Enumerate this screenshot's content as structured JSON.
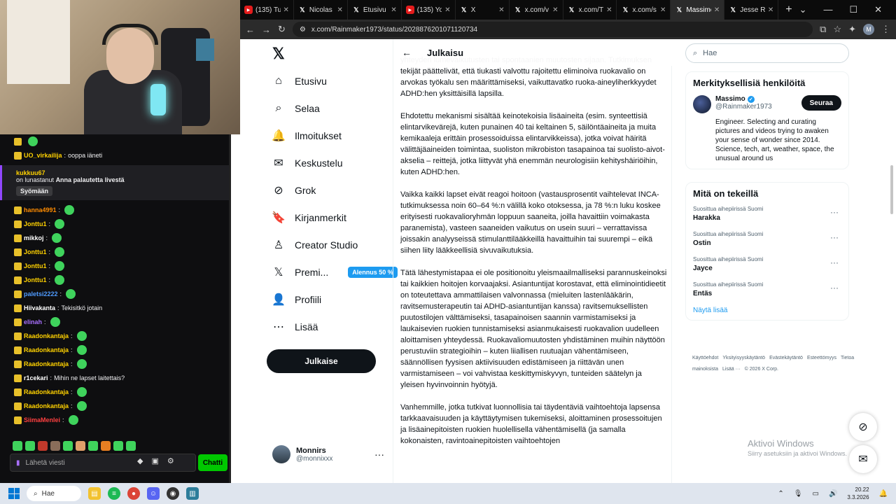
{
  "browser": {
    "tabs": [
      {
        "icon": "youtube-icon",
        "title": "(135) Tu"
      },
      {
        "icon": "x-icon",
        "title": "Nicolas"
      },
      {
        "icon": "x-icon",
        "title": "Etusivu"
      },
      {
        "icon": "youtube-icon",
        "title": "(135) Yo"
      },
      {
        "icon": "x-icon",
        "title": "X"
      },
      {
        "icon": "x-icon",
        "title": "x.com/v"
      },
      {
        "icon": "x-icon",
        "title": "x.com/T"
      },
      {
        "icon": "x-icon",
        "title": "x.com/s"
      },
      {
        "icon": "x-icon",
        "title": "Massimo",
        "active": true
      },
      {
        "icon": "x-icon",
        "title": "Jesse Ru"
      }
    ],
    "url": "x.com/Rainmaker1973/status/2028876201071120734",
    "profile_initial": "M"
  },
  "chat": {
    "lines": [
      {
        "user": "",
        "text": ""
      },
      {
        "user": "UO_virkailija",
        "text": "ooppa iäneti",
        "color": "#ffd200"
      },
      {
        "user": "hanna4991",
        "text": "",
        "color": "#ff8c00"
      },
      {
        "user": "Jonttu1",
        "text": "",
        "color": "#ffd200"
      },
      {
        "user": "mikkoj",
        "text": "",
        "color": "#ffffff"
      },
      {
        "user": "Jonttu1",
        "text": "",
        "color": "#ffd200"
      },
      {
        "user": "Jonttu1",
        "text": "",
        "color": "#ffd200"
      },
      {
        "user": "Jonttu1",
        "text": "",
        "color": "#ffd200"
      },
      {
        "user": "paletsi2222",
        "text": "",
        "color": "#4f9bff"
      },
      {
        "user": "Hiivakanta",
        "text": "Tekisitkö jotain",
        "color": "#ffffff"
      },
      {
        "user": "elinah",
        "text": "",
        "color": "#a970ff"
      },
      {
        "user": "Raadonkantaja",
        "text": "",
        "color": "#ffd200"
      },
      {
        "user": "Raadonkantaja",
        "text": "",
        "color": "#ffd200"
      },
      {
        "user": "Raadonkantaja",
        "text": "",
        "color": "#ffd200"
      },
      {
        "user": "r1cekari",
        "text": "Mihin ne lapset laitettais?",
        "color": "#ffffff"
      },
      {
        "user": "Raadonkantaja",
        "text": "",
        "color": "#ffd200"
      },
      {
        "user": "Raadonkantaja",
        "text": "",
        "color": "#ffd200"
      },
      {
        "user": "SiimaMenlei",
        "text": "",
        "color": "#ff4040"
      }
    ],
    "redeem": {
      "user": "kukkuu67",
      "text_prefix": "on lunastanut",
      "reward": "Anna palautetta livestä",
      "pill": "Syömään"
    },
    "input_placeholder": "Lähetä viesti",
    "send_label": "Chatti"
  },
  "x": {
    "nav": [
      {
        "name": "home",
        "icon": "home-icon",
        "label": "Etusivu",
        "glyph": "⌂"
      },
      {
        "name": "explore",
        "icon": "search-icon",
        "label": "Selaa",
        "glyph": "⌕"
      },
      {
        "name": "notifications",
        "icon": "bell-icon",
        "label": "Ilmoitukset",
        "glyph": "🔔"
      },
      {
        "name": "messages",
        "icon": "mail-icon",
        "label": "Keskustelu",
        "glyph": "✉"
      },
      {
        "name": "grok",
        "icon": "grok-icon",
        "label": "Grok",
        "glyph": "⊘"
      },
      {
        "name": "bookmarks",
        "icon": "bookmark-icon",
        "label": "Kirjanmerkit",
        "glyph": "🔖"
      },
      {
        "name": "creator-studio",
        "icon": "creator-icon",
        "label": "Creator Studio",
        "glyph": "♙"
      },
      {
        "name": "premium",
        "icon": "x-icon",
        "label": "Premi...",
        "glyph": "𝕏"
      },
      {
        "name": "profile",
        "icon": "person-icon",
        "label": "Profiili",
        "glyph": "👤"
      },
      {
        "name": "more",
        "icon": "more-circle-icon",
        "label": "Lisää",
        "glyph": "⋯"
      }
    ],
    "premium_promo": "Alennus 50 %",
    "post_button": "Julkaise",
    "account": {
      "name": "Monnirs",
      "handle": "@monnixxx"
    },
    "header_title": "Julkaisu",
    "article": [
      "yhteyden lumevaikutusten tai spontaanien muutosten sijaan. Tutkimuksen tekijät päättelivät, että tiukasti valvottu rajoitettu eliminoiva ruokavalio on arvokas työkalu sen määrittämiseksi, vaikuttavatko ruoka-aineyliherkkyydet ADHD:hen yksittäisillä lapsilla.",
      "Ehdotettu mekanismi sisältää keinotekoisia lisäaineita (esim. synteettisiä elintarvikevärejä, kuten punainen 40 tai keltainen 5, säilöntäaineita ja muita kemikaaleja erittäin prosessoiduissa elintarvikkeissa), jotka voivat häiritä välittäjäaineiden toimintaa, suoliston mikrobiston tasapainoa tai suolisto-aivot-akselia – reittejä, jotka liittyvät yhä enemmän neurologisiin kehityshäiriöihin, kuten ADHD:hen.",
      "Vaikka kaikki lapset eivät reagoi hoitoon (vastausprosentit vaihtelevat INCA-tutkimuksessa noin 60–64 %:n välillä koko otoksessa, ja 78 %:n luku koskee erityisesti ruokavalioryhmän loppuun saaneita, joilla havaittiin voimakasta paranemista), vasteen saaneiden vaikutus on usein suuri – verrattavissa joissakin analyyseissä stimulanttilääkkeillä havaittuihin tai suurempi – eikä siihen liity lääkkeellisiä sivuvaikutuksia.",
      "Tätä lähestymistapaa ei ole positionoitu yleismaailmalliseksi parannuskeinoksi tai kaikkien hoitojen korvaajaksi. Asiantuntijat korostavat, että eliminointidieetit on toteutettava ammattilaisen valvonnassa (mieluiten lastenlääkärin, ravitsemusterapeutin tai ADHD-asiantuntijan kanssa) ravitsemuksellisten puutostilojen välttämiseksi, tasapainoisen saannin varmistamiseksi ja laukaisevien ruokien tunnistamiseksi asianmukaisesti ruokavalion uudelleen aloittamisen yhteydessä. Ruokavaliomuutosten yhdistäminen muihin näyttöön perustuviin strategioihin – kuten liiallisen ruutuajan vähentämiseen, säännöllisen fyysisen aktiivisuuden edistämiseen ja riittävän unen varmistamiseen – voi vahvistaa keskittymiskyvyn, tunteiden säätelyn ja yleisen hyvinvoinnin hyötyjä.",
      "Vanhemmille, jotka tutkivat luonnollisia tai täydentäviä vaihtoehtoja lapsensa tarkkaavaisuuden ja käyttäytymisen tukemiseksi, aloittaminen prosessoitujen ja lisäainepitoisten ruokien huolellisella vähentämisellä (ja samalla kokonaisten, ravintoainepitoisten vaihtoehtojen"
    ],
    "search_placeholder": "Hae",
    "who_to_follow": {
      "title": "Merkityksellisiä henkilöitä",
      "name": "Massimo",
      "handle": "@Rainmaker1973",
      "follow": "Seuraa",
      "bio": "Engineer. Selecting and curating pictures and videos trying to awaken your sense of wonder since 2014. Science, tech, art, weather, space, the unusual around us"
    },
    "trends": {
      "title": "Mitä on tekeillä",
      "items": [
        {
          "context": "Suosittua aihepiirissä Suomi",
          "name": "Harakka"
        },
        {
          "context": "Suosittua aihepiirissä Suomi",
          "name": "Ostin"
        },
        {
          "context": "Suosittua aihepiirissä Suomi",
          "name": "Jayce"
        },
        {
          "context": "Suosittua aihepiirissä Suomi",
          "name": "Entäs"
        }
      ],
      "show_more": "Näytä lisää"
    },
    "footer": [
      "Käyttöehdot",
      "Yksityisyyskäytäntö",
      "Evästekäytäntö",
      "Esteettömyys",
      "Tietoa mainoksista",
      "Lisää ···",
      "© 2026 X Corp."
    ]
  },
  "windows": {
    "activate_title": "Aktivoi Windows",
    "activate_sub": "Siirry asetuksiin ja aktivoi Windows.",
    "search_label": "Hae",
    "time": "20.22",
    "date": "3.3.2026"
  }
}
